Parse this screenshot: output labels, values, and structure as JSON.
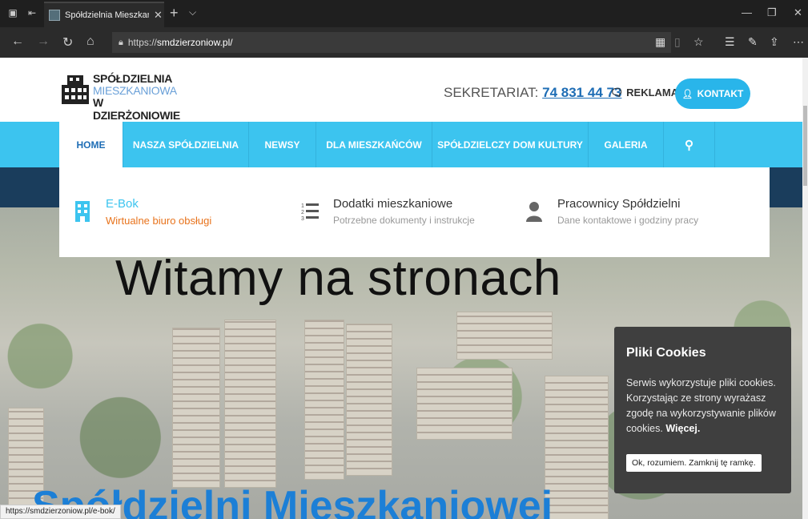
{
  "browser": {
    "tab_title": "Spółdzielnia Mieszkanic",
    "url_protocol": "https://",
    "url_host": "smdzierzoniow.pl/"
  },
  "header": {
    "logo_line1": "SPÓŁDZIELNIA",
    "logo_line2": "MIESZKANIOWA",
    "logo_line3": "W DZIERŻONIOWIE",
    "sekretariat_label": "SEKRETARIAT:",
    "sekretariat_phone": "74 831 44 73",
    "reklama_label": "REKLAMA",
    "kontakt_label": "KONTAKT"
  },
  "menu": {
    "items": [
      {
        "label": "HOME"
      },
      {
        "label": "NASZA SPÓŁDZIELNIA"
      },
      {
        "label": "NEWSY"
      },
      {
        "label": "DLA MIESZKAŃCÓW"
      },
      {
        "label": "SPÓŁDZIELCZY DOM KULTURY"
      },
      {
        "label": "GALERIA"
      }
    ]
  },
  "dropdown": {
    "items": [
      {
        "title": "E-Bok",
        "subtitle": "Wirtualne biuro obsługi",
        "icon": "building-icon"
      },
      {
        "title": "Dodatki mieszkaniowe",
        "subtitle": "Potrzebne dokumenty i instrukcje",
        "icon": "numbered-list-icon"
      },
      {
        "title": "Pracownicy Spółdzielni",
        "subtitle": "Dane kontaktowe i godziny pracy",
        "icon": "user-icon"
      }
    ]
  },
  "hero": {
    "headline": "Witamy na stronach",
    "subheadline": "Spółdzielni Mieszkaniowej"
  },
  "cookies": {
    "title": "Pliki Cookies",
    "body": "Serwis wykorzystuje pliki cookies. Korzystając ze strony wyrażasz zgodę na wykorzystywanie plików cookies.",
    "more_link": "Więcej.",
    "accept_button": "Ok, rozumiem. Zamknij tę ramkę."
  },
  "status_bar": {
    "link_url": "https://smdzierzoniow.pl/e-bok/"
  },
  "colors": {
    "menu_bg": "#3cc4ef",
    "accent_blue": "#1e6db5",
    "kontakt_bg": "#29b5ea",
    "ebok_orange": "#e8731c",
    "cookie_bg": "#3f3f3f"
  }
}
